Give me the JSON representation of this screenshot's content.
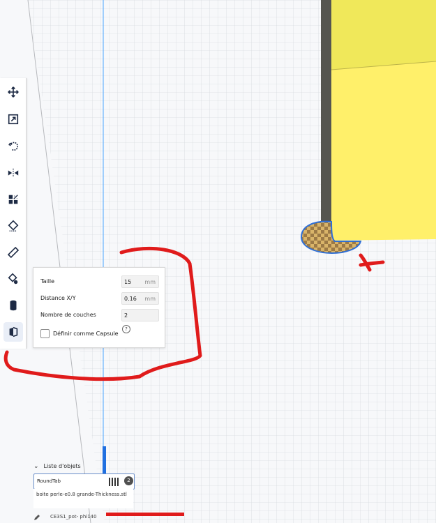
{
  "toolbar": {
    "items": [
      {
        "name": "move-tool",
        "icon": "move-icon"
      },
      {
        "name": "scale-tool",
        "icon": "scale-icon"
      },
      {
        "name": "rotate-tool",
        "icon": "rotate-icon"
      },
      {
        "name": "mirror-tool",
        "icon": "mirror-icon"
      },
      {
        "name": "per-model-settings-tool",
        "icon": "per-model-settings-icon"
      },
      {
        "name": "support-blocker-tool",
        "icon": "support-blocker-icon"
      },
      {
        "name": "measure-tool",
        "icon": "ruler-icon"
      },
      {
        "name": "paint-tool",
        "icon": "paint-icon"
      },
      {
        "name": "cylinder-tool",
        "icon": "cylinder-icon"
      },
      {
        "name": "tab-anti-warping-tool",
        "icon": "tab-icon"
      }
    ]
  },
  "tool_panel": {
    "size_label": "Taille",
    "size_value": "15",
    "size_unit": "mm",
    "xy_label": "Distance X/Y",
    "xy_value": "0.16",
    "xy_unit": "mm",
    "layers_label": "Nombre de couches",
    "layers_value": "2",
    "capsule_label": "Définir comme Capsule",
    "help_icon": "help-icon",
    "help_glyph": "?"
  },
  "object_list": {
    "header": "Liste d'objets",
    "selected_name": "RoundTab",
    "count": "2",
    "file_name": "boite perle-e0.8 grande-Thickness.stl"
  },
  "bottom_bar": {
    "job_name": "CE3S1_pot- phi140"
  },
  "colors": {
    "model_yellow": "#ffee66",
    "tab_blue": "#2f6fd6",
    "annotation_red": "#e01b1b"
  }
}
